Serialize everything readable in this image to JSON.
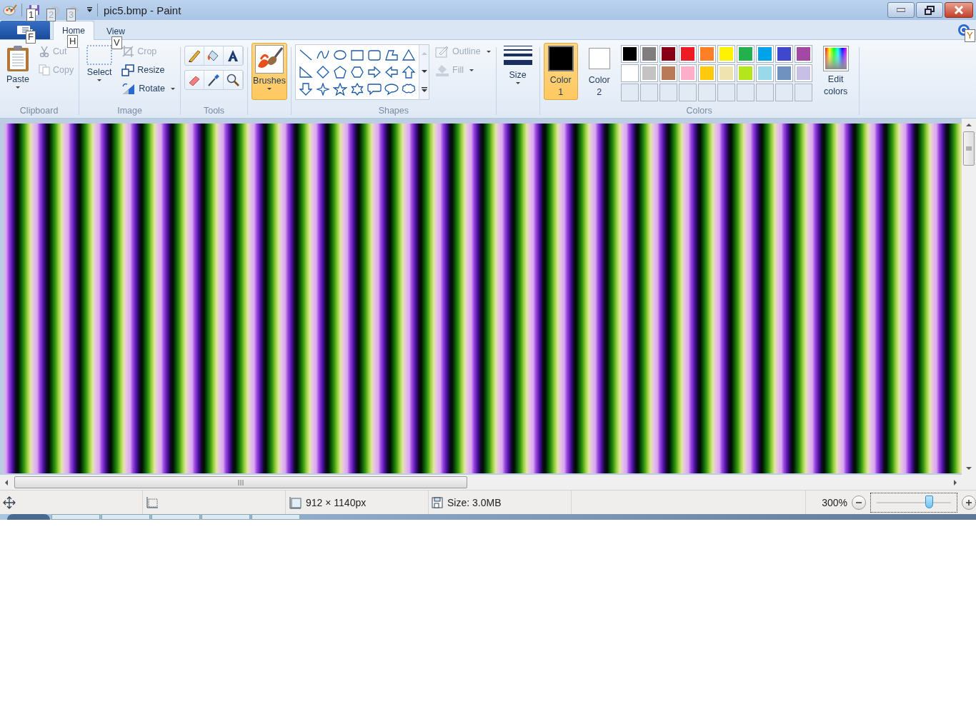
{
  "window": {
    "title": "pic5.bmp - Paint"
  },
  "quick_access": {
    "keytips": [
      "1",
      "2",
      "3"
    ]
  },
  "file_button": {
    "keytip": "F"
  },
  "tabs": [
    {
      "label": "Home",
      "selected": true,
      "keytip": "H"
    },
    {
      "label": "View",
      "selected": false,
      "keytip": "V"
    }
  ],
  "help": {
    "keytip": "Y"
  },
  "clipboard": {
    "label": "Clipboard",
    "paste": "Paste",
    "cut": {
      "label": "Cut",
      "disabled": true
    },
    "copy": {
      "label": "Copy",
      "disabled": true
    }
  },
  "image": {
    "label": "Image",
    "select": "Select",
    "crop": {
      "label": "Crop",
      "disabled": true
    },
    "resize": {
      "label": "Resize",
      "disabled": false
    },
    "rotate": {
      "label": "Rotate",
      "disabled": false
    }
  },
  "tools": {
    "label": "Tools"
  },
  "brushes": {
    "label": "Brushes",
    "selected": true
  },
  "shapes": {
    "label": "Shapes",
    "outline": {
      "label": "Outline",
      "disabled": true
    },
    "fill": {
      "label": "Fill",
      "disabled": true
    }
  },
  "size": {
    "label": "Size"
  },
  "colors": {
    "label": "Colors",
    "color1": {
      "label": "Color 1",
      "selected": true,
      "color": "#000000"
    },
    "color2": {
      "label": "Color 2",
      "selected": false,
      "color": "#ffffff"
    },
    "palette": [
      {
        "color": "#000000"
      },
      {
        "color": "#7f7f7f"
      },
      {
        "color": "#880015"
      },
      {
        "color": "#ed1c24"
      },
      {
        "color": "#ff7f27"
      },
      {
        "color": "#fff200"
      },
      {
        "color": "#22b14c"
      },
      {
        "color": "#00a2e8"
      },
      {
        "color": "#3f48cc"
      },
      {
        "color": "#a349a4"
      },
      {
        "color": "#ffffff"
      },
      {
        "color": "#c3c3c3"
      },
      {
        "color": "#b97a57"
      },
      {
        "color": "#ffaec9"
      },
      {
        "color": "#ffc90e"
      },
      {
        "color": "#efe4b0"
      },
      {
        "color": "#b5e61d"
      },
      {
        "color": "#99d9ea"
      },
      {
        "color": "#7092be"
      },
      {
        "color": "#c8bfe7"
      }
    ],
    "edit": "Edit colors"
  },
  "status_bar": {
    "dimensions": "912 × 1140px",
    "file_size": "Size: 3.0MB",
    "zoom": "300%",
    "zoom_slider": {
      "level": 0.7
    }
  }
}
